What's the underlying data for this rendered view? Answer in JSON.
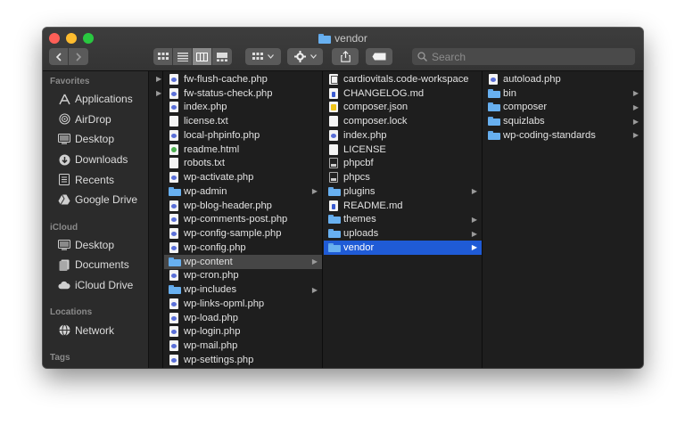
{
  "window": {
    "title": "vendor"
  },
  "search": {
    "placeholder": "Search"
  },
  "sidebar": {
    "favorites_header": "Favorites",
    "favorites": [
      {
        "label": "Applications",
        "icon": "applications-icon"
      },
      {
        "label": "AirDrop",
        "icon": "airdrop-icon"
      },
      {
        "label": "Desktop",
        "icon": "desktop-icon"
      },
      {
        "label": "Downloads",
        "icon": "downloads-icon"
      },
      {
        "label": "Recents",
        "icon": "recents-icon"
      },
      {
        "label": "Google Drive",
        "icon": "google-drive-icon"
      }
    ],
    "icloud_header": "iCloud",
    "icloud": [
      {
        "label": "Desktop",
        "icon": "desktop-icon"
      },
      {
        "label": "Documents",
        "icon": "documents-icon"
      },
      {
        "label": "iCloud Drive",
        "icon": "icloud-icon"
      }
    ],
    "locations_header": "Locations",
    "locations": [
      {
        "label": "Network",
        "icon": "network-icon"
      }
    ],
    "tags_header": "Tags"
  },
  "columns": {
    "col1": [
      {
        "name": "fw-flush-cache.php",
        "type": "php"
      },
      {
        "name": "fw-status-check.php",
        "type": "php"
      },
      {
        "name": "index.php",
        "type": "php"
      },
      {
        "name": "license.txt",
        "type": "txt"
      },
      {
        "name": "local-phpinfo.php",
        "type": "php"
      },
      {
        "name": "readme.html",
        "type": "html"
      },
      {
        "name": "robots.txt",
        "type": "txt"
      },
      {
        "name": "wp-activate.php",
        "type": "php"
      },
      {
        "name": "wp-admin",
        "type": "folder"
      },
      {
        "name": "wp-blog-header.php",
        "type": "php"
      },
      {
        "name": "wp-comments-post.php",
        "type": "php"
      },
      {
        "name": "wp-config-sample.php",
        "type": "php"
      },
      {
        "name": "wp-config.php",
        "type": "php"
      },
      {
        "name": "wp-content",
        "type": "folder",
        "state": "highlighted"
      },
      {
        "name": "wp-cron.php",
        "type": "php"
      },
      {
        "name": "wp-includes",
        "type": "folder"
      },
      {
        "name": "wp-links-opml.php",
        "type": "php"
      },
      {
        "name": "wp-load.php",
        "type": "php"
      },
      {
        "name": "wp-login.php",
        "type": "php"
      },
      {
        "name": "wp-mail.php",
        "type": "php"
      },
      {
        "name": "wp-settings.php",
        "type": "php"
      }
    ],
    "col2": [
      {
        "name": "cardiovitals.code-workspace",
        "type": "ws"
      },
      {
        "name": "CHANGELOG.md",
        "type": "md"
      },
      {
        "name": "composer.json",
        "type": "json"
      },
      {
        "name": "composer.lock",
        "type": "txt"
      },
      {
        "name": "index.php",
        "type": "php"
      },
      {
        "name": "LICENSE",
        "type": "txt"
      },
      {
        "name": "phpcbf",
        "type": "exec"
      },
      {
        "name": "phpcs",
        "type": "exec"
      },
      {
        "name": "plugins",
        "type": "folder"
      },
      {
        "name": "README.md",
        "type": "md"
      },
      {
        "name": "themes",
        "type": "folder"
      },
      {
        "name": "uploads",
        "type": "folder"
      },
      {
        "name": "vendor",
        "type": "folder",
        "state": "selected"
      }
    ],
    "col3": [
      {
        "name": "autoload.php",
        "type": "php"
      },
      {
        "name": "bin",
        "type": "folder"
      },
      {
        "name": "composer",
        "type": "folder"
      },
      {
        "name": "squizlabs",
        "type": "folder"
      },
      {
        "name": "wp-coding-standards",
        "type": "folder"
      }
    ]
  },
  "colors": {
    "selection": "#1f5bd6",
    "folder": "#68b0f0",
    "window_bg": "#1e1e1e"
  }
}
